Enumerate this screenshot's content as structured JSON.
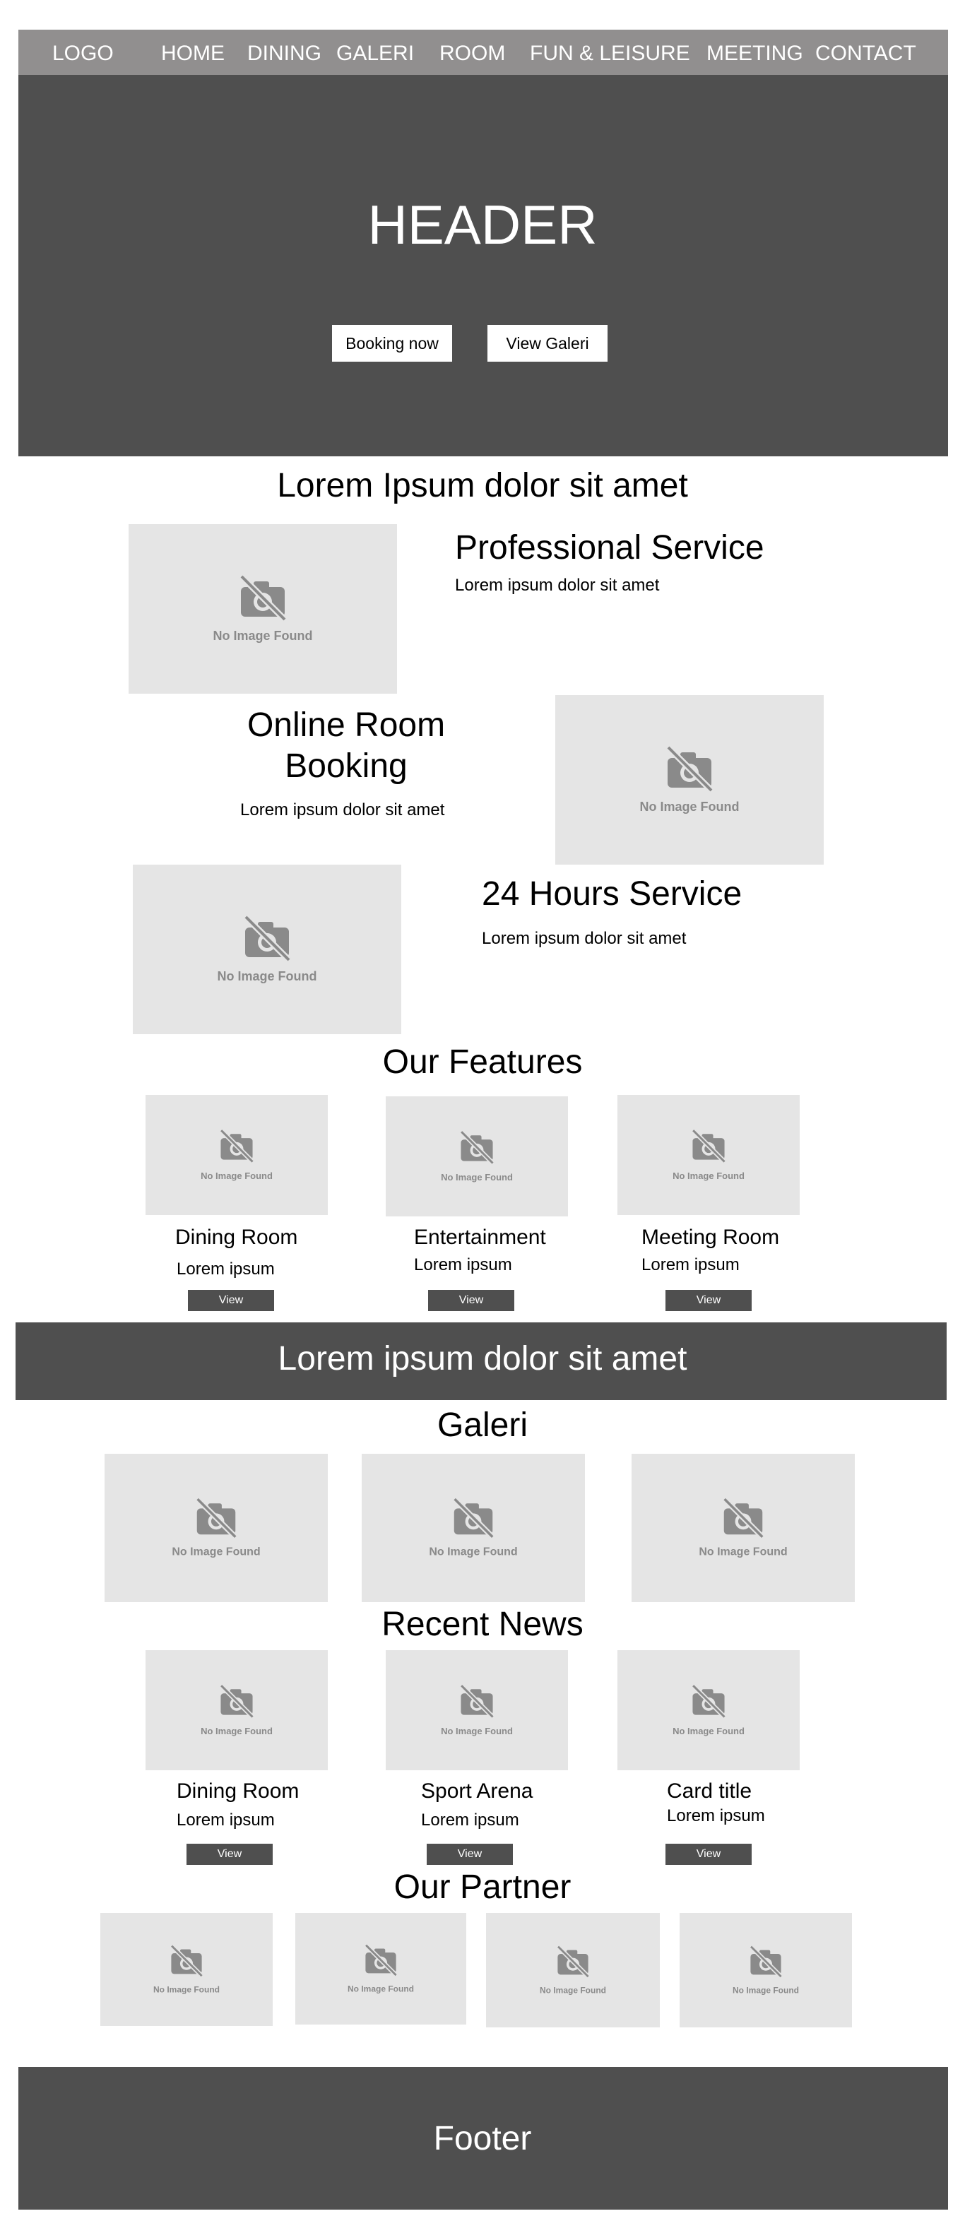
{
  "nav": {
    "logo": "LOGO",
    "items": [
      "HOME",
      "DINING",
      "GALERI",
      "ROOM",
      "FUN & LEISURE",
      "MEETING",
      "CONTACT"
    ]
  },
  "hero": {
    "title": "HEADER",
    "booking_button": "Booking now",
    "galeri_button": "View Galeri"
  },
  "placeholder": {
    "text": "No Image Found",
    "icon": "no-image-camera-icon"
  },
  "intro": {
    "title": "Lorem Ipsum dolor sit amet",
    "services": [
      {
        "title": "Professional Service",
        "text": "Lorem ipsum dolor sit amet"
      },
      {
        "title_line1": "Online Room",
        "title_line2": "Booking",
        "text": "Lorem ipsum dolor sit amet"
      },
      {
        "title": "24 Hours Service",
        "text": "Lorem ipsum dolor sit amet"
      }
    ]
  },
  "features": {
    "title": "Our Features",
    "items": [
      {
        "title": "Dining Room",
        "text": "Lorem ipsum",
        "button": "View"
      },
      {
        "title": "Entertainment",
        "text": "Lorem ipsum",
        "button": "View"
      },
      {
        "title": "Meeting Room",
        "text": "Lorem ipsum",
        "button": "View"
      }
    ]
  },
  "band": {
    "text": "Lorem ipsum dolor sit amet"
  },
  "galeri": {
    "title": "Galeri"
  },
  "news": {
    "title": "Recent News",
    "items": [
      {
        "title": "Dining Room",
        "text": "Lorem ipsum",
        "button": "View"
      },
      {
        "title": "Sport Arena",
        "text": "Lorem ipsum",
        "button": "View"
      },
      {
        "title": "Card title",
        "text": "Lorem ipsum",
        "button": "View"
      }
    ]
  },
  "partner": {
    "title": "Our Partner"
  },
  "footer": {
    "text": "Footer"
  },
  "colors": {
    "nav_bg": "#918f8f",
    "dark": "#4f4f4f",
    "placeholder_bg": "#e5e5e5",
    "placeholder_fg": "#8a8a8a"
  }
}
